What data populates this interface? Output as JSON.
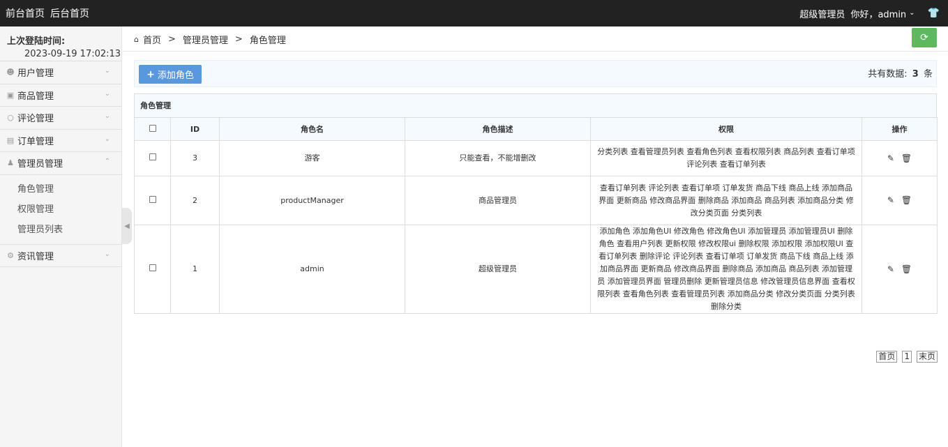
{
  "topbar": {
    "front_home": "前台首页",
    "back_home": "后台首页",
    "role": "超级管理员",
    "greeting": "你好，admin",
    "theme_icon": "shirt-icon"
  },
  "sidebar": {
    "login_title": "上次登陆时间:",
    "login_time": "2023-09-19 17:02:13",
    "items": [
      {
        "label": "用户管理",
        "icon": "user-icon"
      },
      {
        "label": "商品管理",
        "icon": "shopping-bag-icon"
      },
      {
        "label": "评论管理",
        "icon": "comment-icon"
      },
      {
        "label": "订单管理",
        "icon": "card-icon"
      },
      {
        "label": "管理员管理",
        "icon": "admin-icon"
      },
      {
        "label": "资讯管理",
        "icon": "gear-icon"
      }
    ],
    "sub_items": [
      "角色管理",
      "权限管理",
      "管理员列表"
    ]
  },
  "breadcrumb": {
    "home": "首页",
    "level1": "管理员管理",
    "level2": "角色管理",
    "sep": ">"
  },
  "toolbar": {
    "add_label": "添加角色",
    "total_prefix": "共有数据:",
    "total_count": "3",
    "total_suffix": "条"
  },
  "table": {
    "caption": "角色管理",
    "headers": {
      "id": "ID",
      "name": "角色名",
      "desc": "角色描述",
      "perms": "权限",
      "ops": "操作"
    },
    "rows": [
      {
        "id": "3",
        "name": "游客",
        "desc": "只能查看，不能增删改",
        "perms": "分类列表 查看管理员列表 查看角色列表 查看权限列表 商品列表 查看订单项 评论列表 查看订单列表"
      },
      {
        "id": "2",
        "name": "productManager",
        "desc": "商品管理员",
        "perms": "查看订单列表 评论列表 查看订单项 订单发货 商品下线 商品上线 添加商品界面 更新商品 修改商品界面 删除商品 添加商品 商品列表 添加商品分类 修改分类页面 分类列表"
      },
      {
        "id": "1",
        "name": "admin",
        "desc": "超级管理员",
        "perms": "添加角色 添加角色UI 修改角色 修改角色UI 添加管理员 添加管理员UI 删除角色 查看用户列表 更新权限 修改权限ui 删除权限 添加权限 添加权限UI 查看订单列表 删除评论 评论列表 查看订单项 订单发货 商品下线 商品上线 添加商品界面 更新商品 修改商品界面 删除商品 添加商品 商品列表 添加管理员 添加管理员界面 管理员删除 更新管理员信息 修改管理员信息界面 查看权限列表 查看角色列表 查看管理员列表 添加商品分类 修改分类页面 分类列表 删除分类"
      }
    ]
  },
  "pager": {
    "first": "首页",
    "page": "1",
    "last": "末页"
  }
}
